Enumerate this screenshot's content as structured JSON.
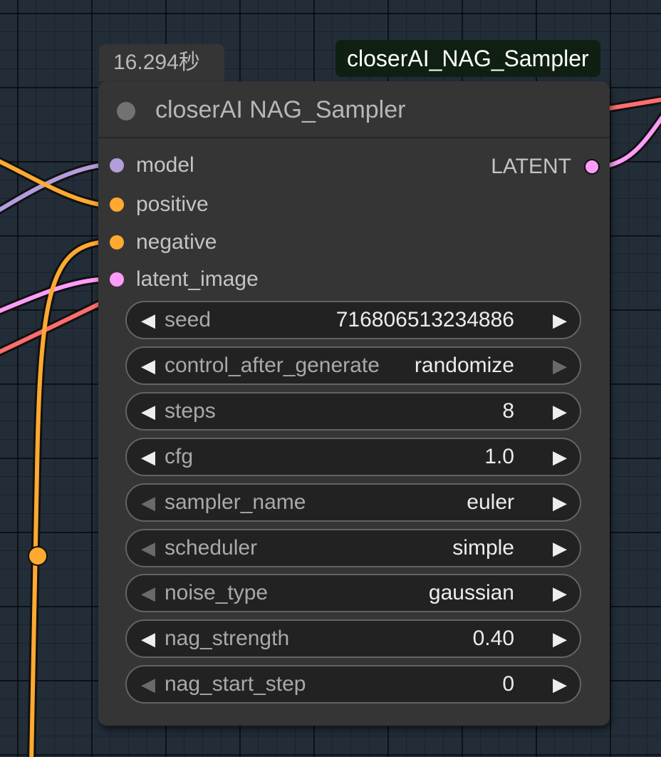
{
  "execution_time": "16.294秒",
  "title_badge": "closerAI_NAG_Sampler",
  "node": {
    "title": "closerAI NAG_Sampler",
    "inputs": [
      {
        "name": "model",
        "color": "#b39ddb"
      },
      {
        "name": "positive",
        "color": "#ffa931"
      },
      {
        "name": "negative",
        "color": "#ffa931"
      },
      {
        "name": "latent_image",
        "color": "#ff9cf9"
      }
    ],
    "output": {
      "name": "LATENT",
      "color": "#ff9cf9"
    },
    "widgets": [
      {
        "name": "seed",
        "value": "716806513234886",
        "left_arrow_enabled": true,
        "right_arrow_enabled": true
      },
      {
        "name": "control_after_generate",
        "value": "randomize",
        "left_arrow_enabled": true,
        "right_arrow_enabled": false
      },
      {
        "name": "steps",
        "value": "8",
        "left_arrow_enabled": true,
        "right_arrow_enabled": true
      },
      {
        "name": "cfg",
        "value": "1.0",
        "left_arrow_enabled": true,
        "right_arrow_enabled": true
      },
      {
        "name": "sampler_name",
        "value": "euler",
        "left_arrow_enabled": false,
        "right_arrow_enabled": true
      },
      {
        "name": "scheduler",
        "value": "simple",
        "left_arrow_enabled": false,
        "right_arrow_enabled": true
      },
      {
        "name": "noise_type",
        "value": "gaussian",
        "left_arrow_enabled": false,
        "right_arrow_enabled": true
      },
      {
        "name": "nag_strength",
        "value": "0.40",
        "left_arrow_enabled": true,
        "right_arrow_enabled": true
      },
      {
        "name": "nag_start_step",
        "value": "0",
        "left_arrow_enabled": false,
        "right_arrow_enabled": true
      }
    ]
  },
  "colors": {
    "canvas_background": "#222d38",
    "node_background": "#353535",
    "widget_background": "#222222",
    "model_link": "#b39ddb",
    "conditioning_link": "#ffa931",
    "latent_link": "#ff9cf9",
    "image_link": "#ff6e6e",
    "title_badge_background": "#0f1f12"
  },
  "icons": {
    "decrement": "left-triangle",
    "increment": "right-triangle"
  }
}
